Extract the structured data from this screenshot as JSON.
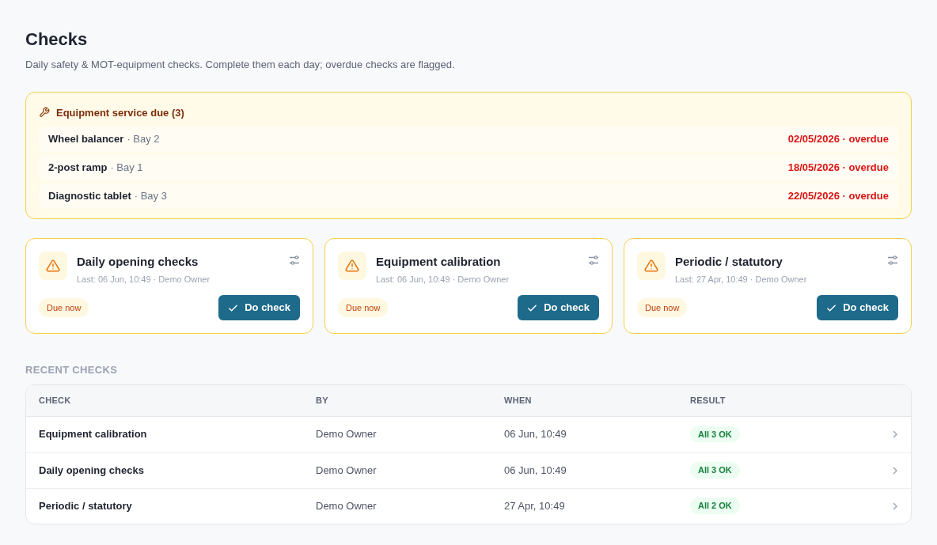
{
  "page": {
    "title": "Checks",
    "subtitle": "Daily safety & MOT-equipment checks. Complete them each day; overdue checks are flagged."
  },
  "service_due": {
    "title": "Equipment service due (3)",
    "items": [
      {
        "name": "Wheel balancer",
        "location": "· Bay 2",
        "due": "02/05/2026 · overdue"
      },
      {
        "name": "2-post ramp",
        "location": "· Bay 1",
        "due": "18/05/2026 · overdue"
      },
      {
        "name": "Diagnostic tablet",
        "location": "· Bay 3",
        "due": "22/05/2026 · overdue"
      }
    ]
  },
  "check_cards": [
    {
      "title": "Daily opening checks",
      "last": "Last: 06 Jun, 10:49 · Demo Owner",
      "status": "Due now",
      "action": "Do check"
    },
    {
      "title": "Equipment calibration",
      "last": "Last: 06 Jun, 10:49 · Demo Owner",
      "status": "Due now",
      "action": "Do check"
    },
    {
      "title": "Periodic / statutory",
      "last": "Last: 27 Apr, 10:49 · Demo Owner",
      "status": "Due now",
      "action": "Do check"
    }
  ],
  "recent_checks": {
    "heading": "RECENT CHECKS",
    "columns": [
      "CHECK",
      "BY",
      "WHEN",
      "RESULT"
    ],
    "rows": [
      {
        "check": "Equipment calibration",
        "by": "Demo Owner",
        "when": "06 Jun, 10:49",
        "result": "All 3 OK"
      },
      {
        "check": "Daily opening checks",
        "by": "Demo Owner",
        "when": "06 Jun, 10:49",
        "result": "All 3 OK"
      },
      {
        "check": "Periodic / statutory",
        "by": "Demo Owner",
        "when": "27 Apr, 10:49",
        "result": "All 2 OK"
      }
    ]
  }
}
